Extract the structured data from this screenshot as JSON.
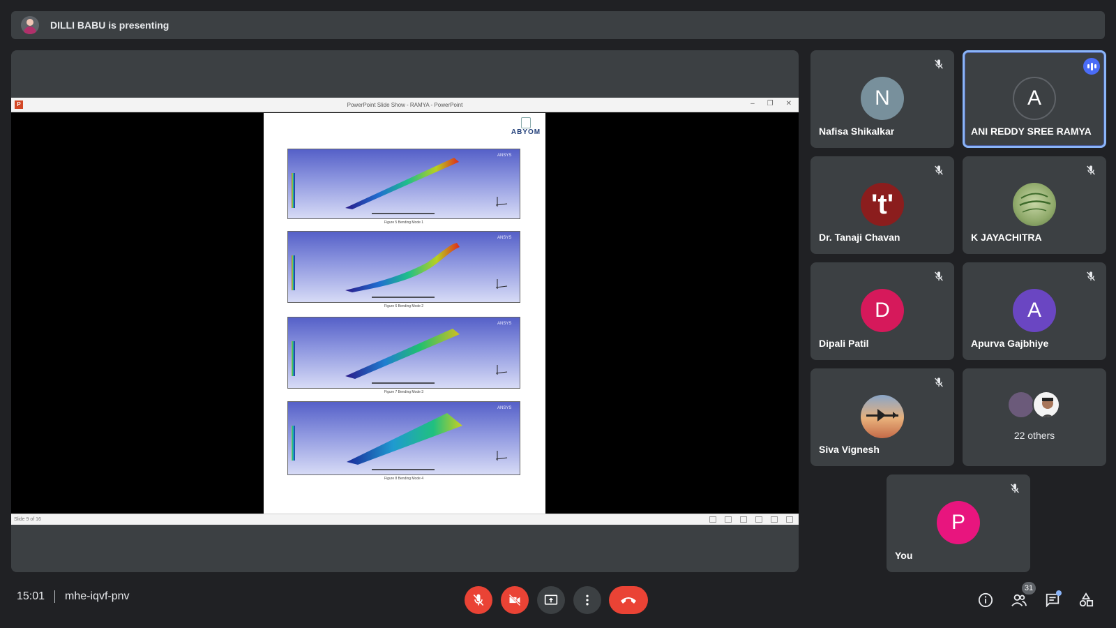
{
  "banner": {
    "presenter_text": "DILLI BABU is presenting"
  },
  "presentation": {
    "window_title": "PowerPoint Slide Show - RAMYA - PowerPoint",
    "status_text": "Slide 9 of 16",
    "logo_text": "ABYOM",
    "figure_tag": "ANSYS",
    "captions": [
      "Figure 5 Bending Mode 1",
      "Figure 6 Bending Mode 2",
      "Figure 7 Bending Mode 3",
      "Figure 8 Bending Mode 4"
    ]
  },
  "participants": [
    {
      "name": "Nafisa Shikalkar",
      "initial": "N",
      "color": "#78909c",
      "muted": true
    },
    {
      "name": "ANI REDDY SREE RAMYA",
      "initial": "A",
      "color": "#3c4043",
      "muted": false,
      "speaking": true
    },
    {
      "name": "Dr. Tanaji Chavan",
      "initial": "'t'",
      "color": "#8b1d1d",
      "muted": true
    },
    {
      "name": "K JAYACHITRA",
      "initial": "",
      "color": "#8fa96a",
      "muted": true
    },
    {
      "name": "Dipali Patil",
      "initial": "D",
      "color": "#d6195b",
      "muted": true
    },
    {
      "name": "Apurva Gajbhiye",
      "initial": "A",
      "color": "#6a46c2",
      "muted": true
    },
    {
      "name": "Siva Vignesh",
      "initial": "",
      "color": "#e3a564",
      "muted": true
    }
  ],
  "others": {
    "label": "22 others"
  },
  "self": {
    "name": "You",
    "initial": "P",
    "color": "#e8157e"
  },
  "meeting": {
    "time": "15:01",
    "code": "mhe-iqvf-pnv"
  },
  "toolbar": {
    "participant_count": "31"
  },
  "colors": {
    "background": "#202124",
    "tile": "#3c4043",
    "danger": "#ea4335",
    "accent": "#8ab4f8"
  }
}
